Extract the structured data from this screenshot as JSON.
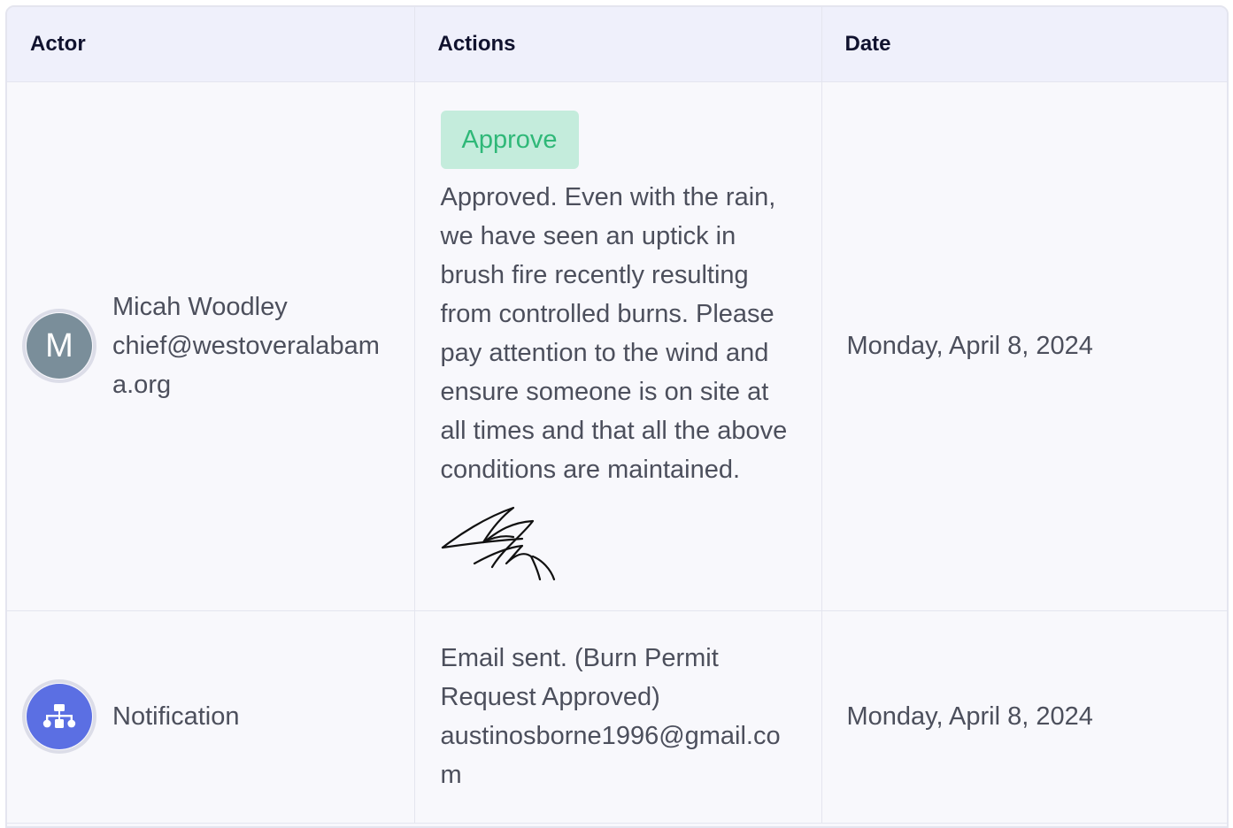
{
  "columns": {
    "actor": "Actor",
    "actions": "Actions",
    "date": "Date"
  },
  "rows": [
    {
      "avatar_letter": "M",
      "avatar_color": "#7a8e9a",
      "actor_name": "Micah Woodley",
      "actor_email": "chief@westoveralabama.org",
      "badge_label": "Approve",
      "badge_color": "#2fb878",
      "comment": "Approved. Even with the rain, we have seen an uptick in brush fire recently resulting from controlled burns. Please pay attention to the wind and ensure someone is on site at all times and that all the above conditions are maintained.",
      "has_signature": true,
      "date": "Monday, April 8, 2024"
    },
    {
      "avatar_icon": "sitemap-icon",
      "avatar_color": "#5b6fe3",
      "actor_name": "Notification",
      "comment": "Email sent. (Burn Permit Request Approved) austinosborne1996@gmail.com",
      "date": "Monday, April 8, 2024"
    }
  ]
}
